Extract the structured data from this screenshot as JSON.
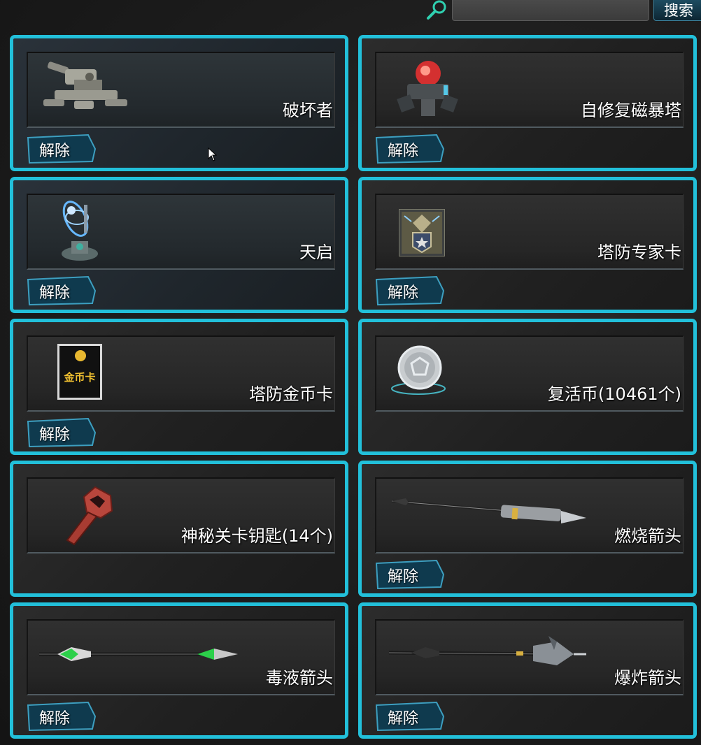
{
  "search": {
    "placeholder": "",
    "value": "",
    "button_label": "搜索",
    "icon": "search-icon"
  },
  "items": [
    {
      "name": "破坏者",
      "icon": "destroyer-turret-icon",
      "action": "解除"
    },
    {
      "name": "自修复磁暴塔",
      "icon": "tesla-tower-icon",
      "action": "解除"
    },
    {
      "name": "天启",
      "icon": "apocalypse-tower-icon",
      "action": "解除"
    },
    {
      "name": "塔防专家卡",
      "icon": "tower-expert-card-icon",
      "action": "解除"
    },
    {
      "name": "塔防金币卡",
      "icon": "gold-coin-card-icon",
      "action": "解除",
      "card_text": "金币卡"
    },
    {
      "name": "复活币(10461个)",
      "icon": "revive-coin-icon"
    },
    {
      "name": "神秘关卡钥匙(14个)",
      "icon": "mystery-key-icon"
    },
    {
      "name": "燃烧箭头",
      "icon": "fire-arrow-icon",
      "action": "解除"
    },
    {
      "name": "毒液箭头",
      "icon": "venom-arrow-icon",
      "action": "解除"
    },
    {
      "name": "爆炸箭头",
      "icon": "explosive-arrow-icon",
      "action": "解除"
    }
  ],
  "colors": {
    "card_border": "#22c0da",
    "button_fill": "#0f3a4e",
    "background": "#1c1c1c"
  }
}
